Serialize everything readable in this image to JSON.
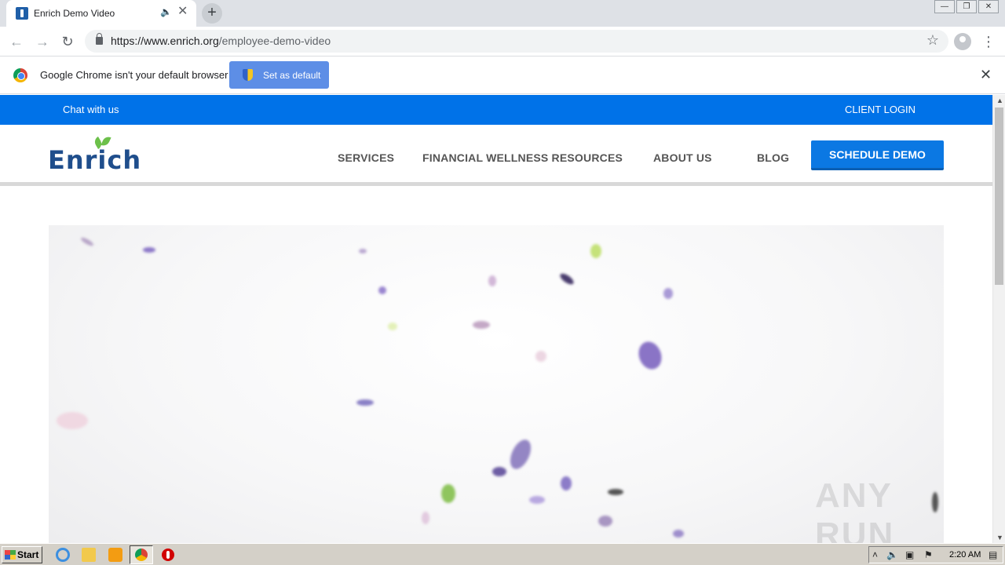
{
  "browser": {
    "tab_title": "Enrich Demo Video",
    "url_domain": "https://www.enrich.org",
    "url_path": "/employee-demo-video"
  },
  "infobar": {
    "message": "Google Chrome isn't your default browser",
    "button_label": "Set as default"
  },
  "site": {
    "topbar": {
      "chat": "Chat with us",
      "login": "CLIENT LOGIN"
    },
    "logo_text": "Enrich",
    "nav": {
      "services": "SERVICES",
      "resources": "FINANCIAL WELLNESS RESOURCES",
      "about": "ABOUT US",
      "blog": "BLOG"
    },
    "cta": "SCHEDULE DEMO"
  },
  "watermark": "ANY RUN",
  "taskbar": {
    "start": "Start",
    "clock": "2:20 AM"
  },
  "colors": {
    "brand_blue": "#0072e8",
    "logo_navy": "#1f4e8c",
    "leaf_green": "#6cc04a"
  }
}
